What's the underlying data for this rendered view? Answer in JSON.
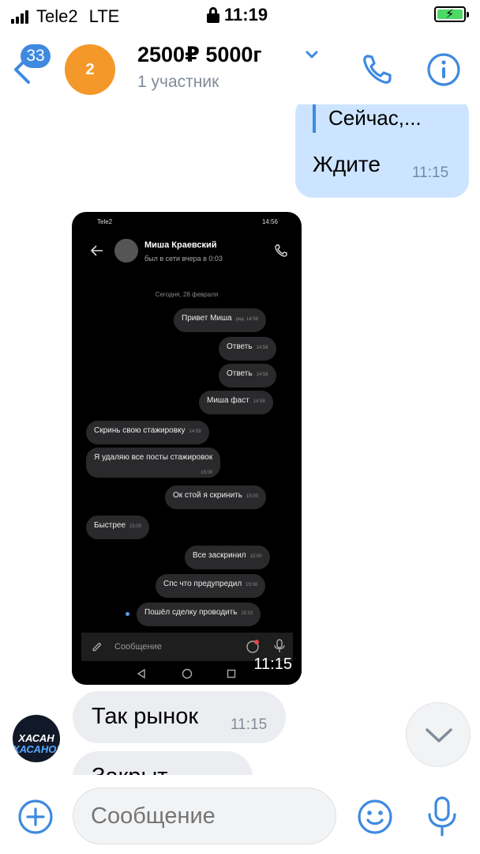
{
  "status_bar": {
    "carrier": "Tele2",
    "network": "LTE",
    "time": "11:19"
  },
  "header": {
    "unread_count": "33",
    "avatar_text": "2",
    "title": "2500₽ 5000г",
    "subtitle": "1 участник"
  },
  "messages": {
    "outgoing": {
      "reply_preview": "Сейчас,...",
      "text": "Ждите",
      "time": "11:15"
    },
    "photo": {
      "time": "11:15"
    },
    "incoming": [
      {
        "text": "Так рынок",
        "time": "11:15"
      },
      {
        "text": "Закрыт"
      }
    ]
  },
  "composer": {
    "placeholder": "Сообщение"
  },
  "embedded_screenshot": {
    "status_carrier": "Tele2",
    "status_time": "14:56",
    "contact_name": "Миша Краевский",
    "contact_status": "был в сети вчера в 0:03",
    "date_separator": "Сегодня, 28 февраля",
    "messages": [
      {
        "text": "Привет Миша",
        "time": "ред. 14:58",
        "side": "out"
      },
      {
        "text": "Ответь",
        "time": "14:58",
        "side": "out"
      },
      {
        "text": "Ответь",
        "time": "14:58",
        "side": "out"
      },
      {
        "text": "Миша фаст",
        "time": "14:58",
        "side": "out"
      },
      {
        "text": "Скринь свою стажировку",
        "time": "14:59",
        "side": "in"
      },
      {
        "text": "Я удаляю все посты стажировок",
        "time": "15:00",
        "side": "in"
      },
      {
        "text": "Ок стой я скринить",
        "time": "15:00",
        "side": "out"
      },
      {
        "text": "Быстрее",
        "time": "15:00",
        "side": "in"
      },
      {
        "text": "Все заскринил",
        "time": "15:00",
        "side": "out"
      },
      {
        "text": "Спс что предупредил",
        "time": "15:00",
        "side": "out"
      },
      {
        "text": "Пошёл сделку проводить",
        "time": "15:02",
        "side": "out"
      }
    ],
    "input_placeholder": "Сообщение"
  },
  "avatar_caption": {
    "line1": "ХАСАН",
    "line2": "ХАСАНОВ"
  },
  "colors": {
    "accent": "#3f8ae0",
    "outgoing_bubble": "#cce4ff",
    "incoming_bubble": "#ebedf0",
    "group_avatar": "#f4982a"
  }
}
